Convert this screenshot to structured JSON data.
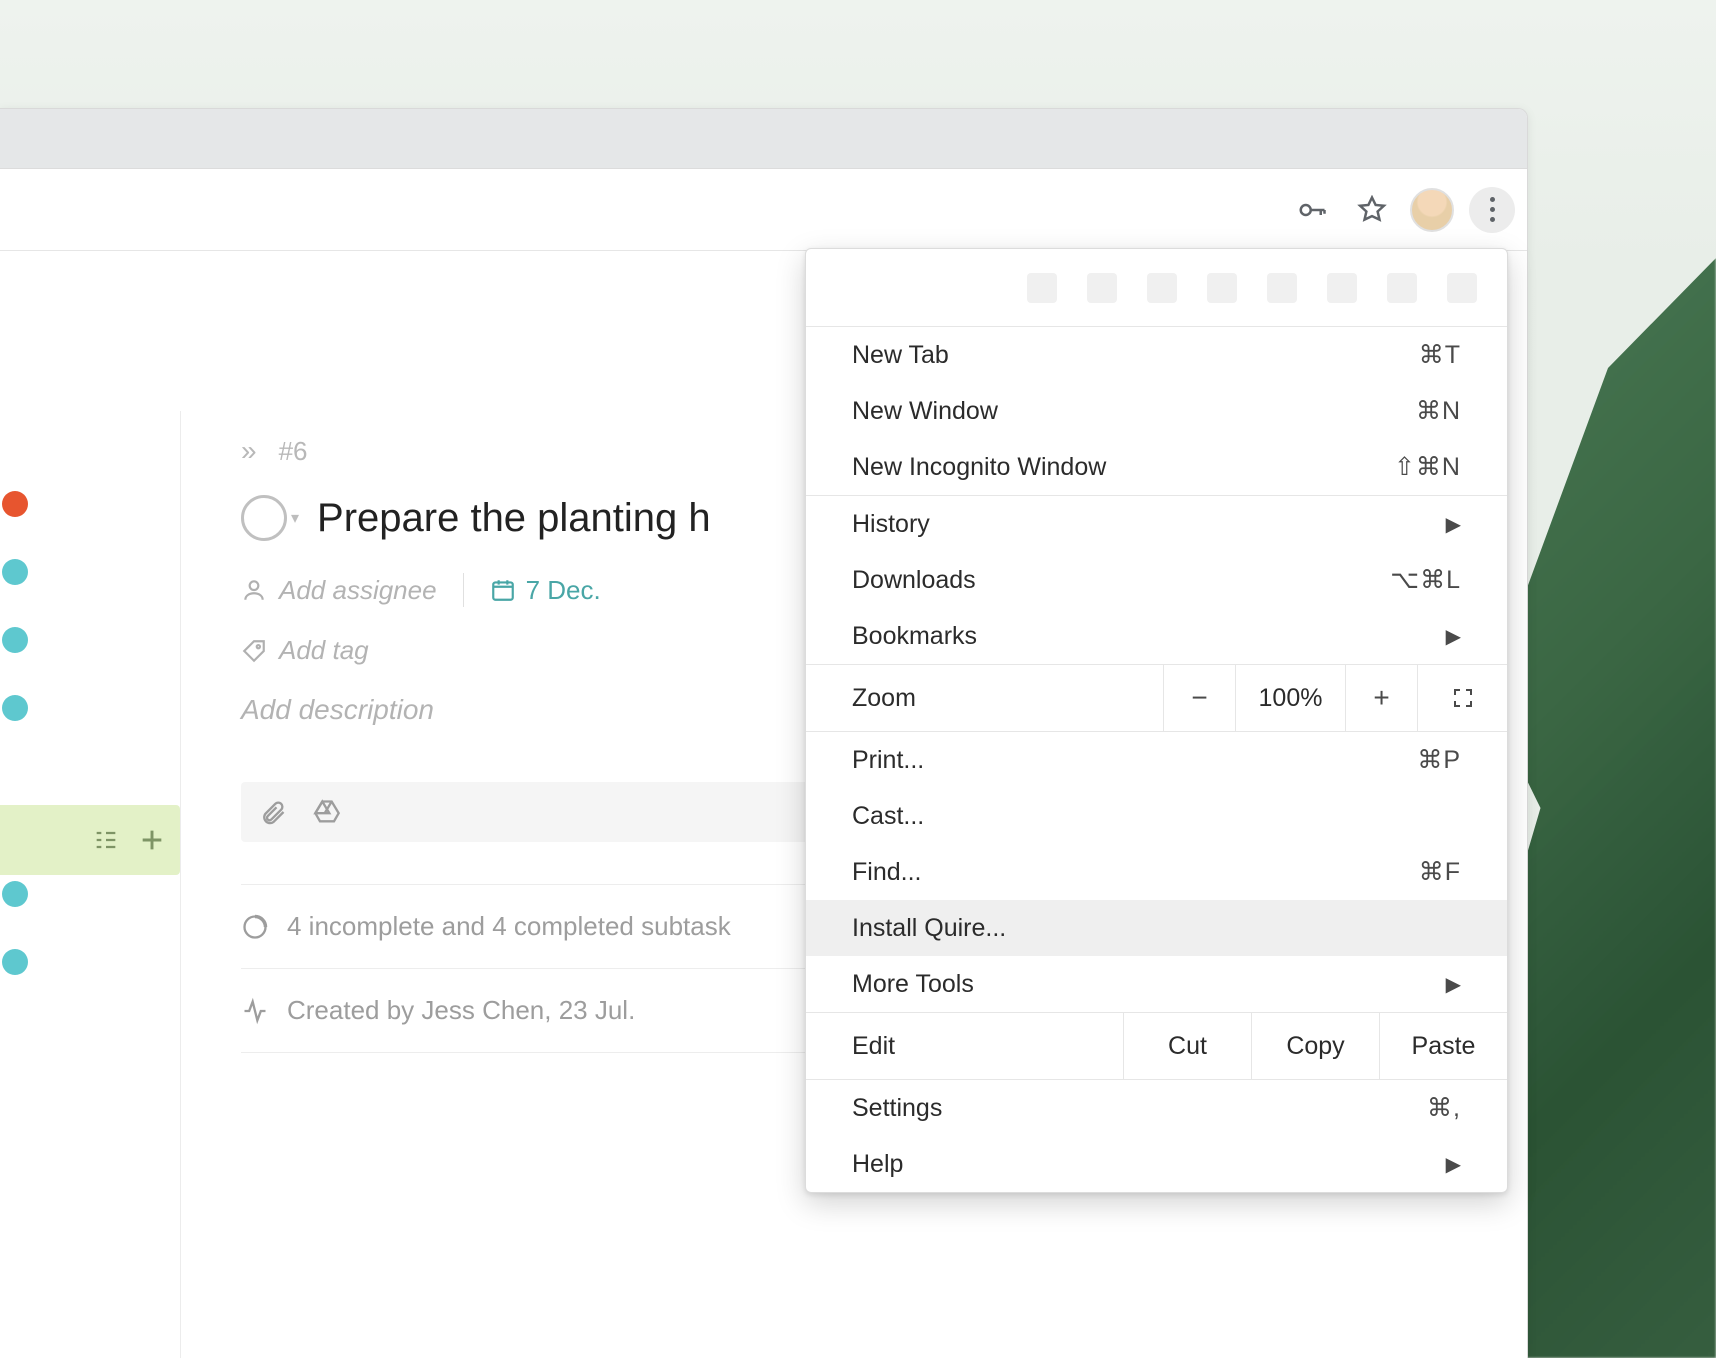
{
  "task": {
    "id_label": "#6",
    "title": "Prepare the planting h",
    "assignee_placeholder": "Add assignee",
    "due_date": "7 Dec.",
    "tag_placeholder": "Add tag",
    "description_placeholder": "Add description",
    "subtasks_summary": "4 incomplete and 4 completed subtask",
    "activity": "Created by Jess Chen, 23 Jul."
  },
  "chrome_menu": {
    "new_tab": {
      "label": "New Tab",
      "shortcut": "⌘T"
    },
    "new_window": {
      "label": "New Window",
      "shortcut": "⌘N"
    },
    "new_incognito": {
      "label": "New Incognito Window",
      "shortcut": "⇧⌘N"
    },
    "history": {
      "label": "History"
    },
    "downloads": {
      "label": "Downloads",
      "shortcut": "⌥⌘L"
    },
    "bookmarks": {
      "label": "Bookmarks"
    },
    "zoom_label": "Zoom",
    "zoom_value": "100%",
    "print": {
      "label": "Print...",
      "shortcut": "⌘P"
    },
    "cast": {
      "label": "Cast..."
    },
    "find": {
      "label": "Find...",
      "shortcut": "⌘F"
    },
    "install": {
      "label": "Install Quire..."
    },
    "more_tools": {
      "label": "More Tools"
    },
    "edit_label": "Edit",
    "cut": "Cut",
    "copy": "Copy",
    "paste": "Paste",
    "settings": {
      "label": "Settings",
      "shortcut": "⌘,"
    },
    "help": {
      "label": "Help"
    }
  }
}
